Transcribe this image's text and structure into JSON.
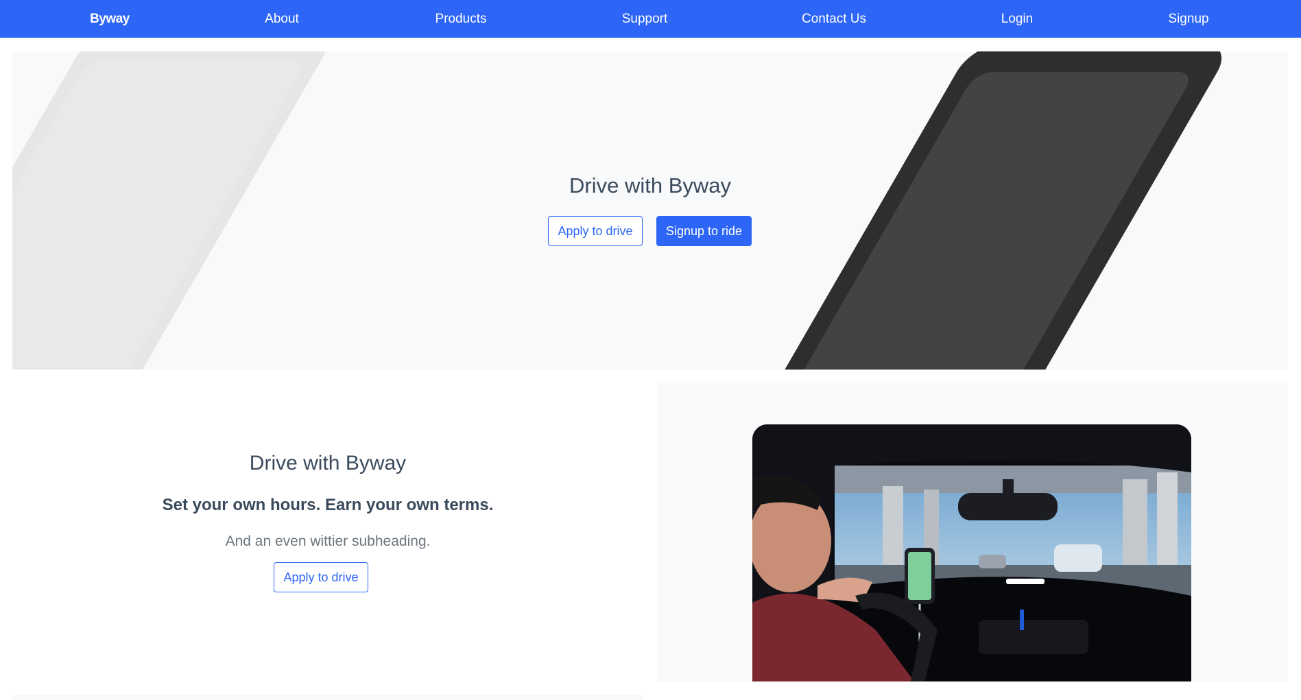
{
  "nav": {
    "brand": "Byway",
    "links": [
      "About",
      "Products",
      "Support",
      "Contact Us",
      "Login",
      "Signup"
    ]
  },
  "hero": {
    "title": "Drive with Byway",
    "apply_label": "Apply to drive",
    "signup_label": "Signup to ride"
  },
  "feature": {
    "title": "Drive with Byway",
    "subtitle": "Set your own hours. Earn your own terms.",
    "lead": "And an even wittier subheading.",
    "apply_label": "Apply to drive"
  },
  "colors": {
    "primary": "#2d66f6",
    "text": "#3a4a5c",
    "muted": "#6c757d",
    "panel": "#f8f9fa"
  },
  "icons": {
    "hero_left": "phone-outline-light",
    "hero_right": "phone-outline-dark",
    "feature_image": "driver-with-phone-photo"
  }
}
